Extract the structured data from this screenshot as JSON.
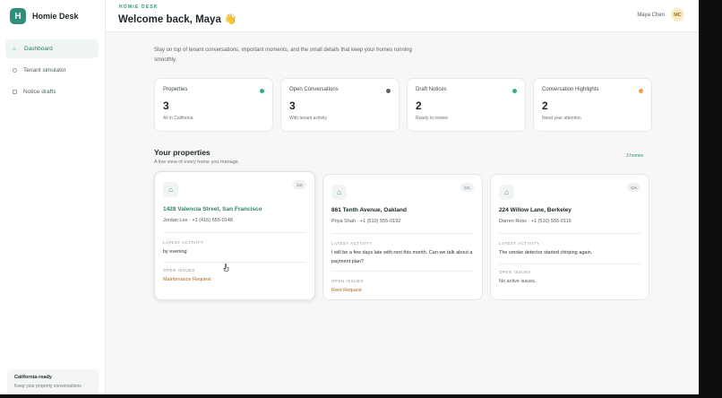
{
  "app": {
    "name": "Homie Desk",
    "logo_letter": "H"
  },
  "sidebar": {
    "items": [
      {
        "label": "Dashboard",
        "icon": "home-icon",
        "active": true
      },
      {
        "label": "Tenant simulator",
        "icon": "circle-icon",
        "active": false
      },
      {
        "label": "Notice drafts",
        "icon": "document-icon",
        "active": false
      }
    ],
    "footer": {
      "title": "California-ready",
      "subtitle": "Keep your property conversations"
    }
  },
  "header": {
    "eyebrow": "HOMIE DESK",
    "title": "Welcome back, Maya 👋",
    "user_name": "Maya Chen",
    "user_initials": "MC"
  },
  "main": {
    "intro": "Stay on top of tenant conversations, important moments, and the small details that keep your homes running smoothly.",
    "stats": [
      {
        "label": "Properties",
        "value": "3",
        "sub": "All in California",
        "dot_color": "#3aa98a"
      },
      {
        "label": "Open Conversations",
        "value": "3",
        "sub": "With tenant activity",
        "dot_color": "#5d6468"
      },
      {
        "label": "Draft Notices",
        "value": "2",
        "sub": "Ready to review",
        "dot_color": "#3aa98a"
      },
      {
        "label": "Conversation Highlights",
        "value": "2",
        "sub": "Need your attention",
        "dot_color": "#f0a040"
      }
    ],
    "properties_title": "Your properties",
    "properties_subtitle": "A live view of every home you manage.",
    "homes_count": "3 homes",
    "latest_activity_label": "LATEST ACTIVITY",
    "open_issues_label": "OPEN ISSUES",
    "cards": [
      {
        "state": "CA",
        "address": "1428 Valencia Street, San Francisco",
        "contact": "Jordan Lee · +1 (415) 555-0148",
        "activity": "by evening",
        "issue": "Maintenance Request",
        "issue_type": "warn"
      },
      {
        "state": "CA",
        "address": "861 Tenth Avenue, Oakland",
        "contact": "Priya Shah · +1 (510) 555-0192",
        "activity": "I will be a few days late with rent this month. Can we talk about a payment plan?",
        "issue": "Rent Request",
        "issue_type": "warn"
      },
      {
        "state": "CA",
        "address": "224 Willow Lane, Berkeley",
        "contact": "Darren Ross · +1 (510) 555-0116",
        "activity": "The smoke detector started chirping again.",
        "issue": "No active issues.",
        "issue_type": "none"
      }
    ]
  },
  "colors": {
    "accent": "#2f8f7a",
    "warning": "#a8651b"
  }
}
